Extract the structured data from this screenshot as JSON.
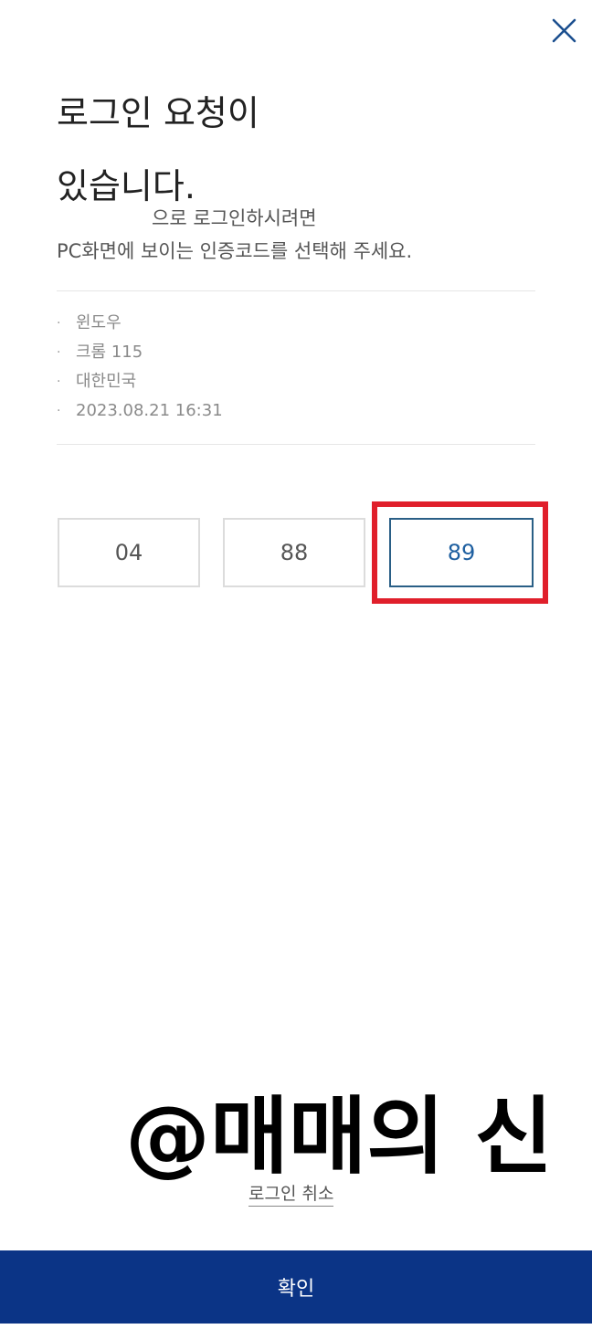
{
  "header": {
    "close_icon": "close-icon"
  },
  "title": {
    "line1": "로그인 요청이",
    "line2": "있습니다."
  },
  "description": {
    "line1": "으로 로그인하시려면",
    "line2": "PC화면에 보이는 인증코드를 선택해 주세요."
  },
  "info": {
    "bullet": "·",
    "items": [
      "윈도우",
      "크롬 115",
      "대한민국",
      "2023.08.21 16:31"
    ]
  },
  "codes": {
    "options": [
      "04",
      "88",
      "89"
    ],
    "selected": "89"
  },
  "watermark": "@매매의 신",
  "cancel_label": "로그인 취소",
  "confirm_label": "확인",
  "colors": {
    "primary": "#0b3486",
    "selected_border": "#2a5f86",
    "selected_text": "#1e5fa0",
    "highlight": "#e01f2b"
  }
}
